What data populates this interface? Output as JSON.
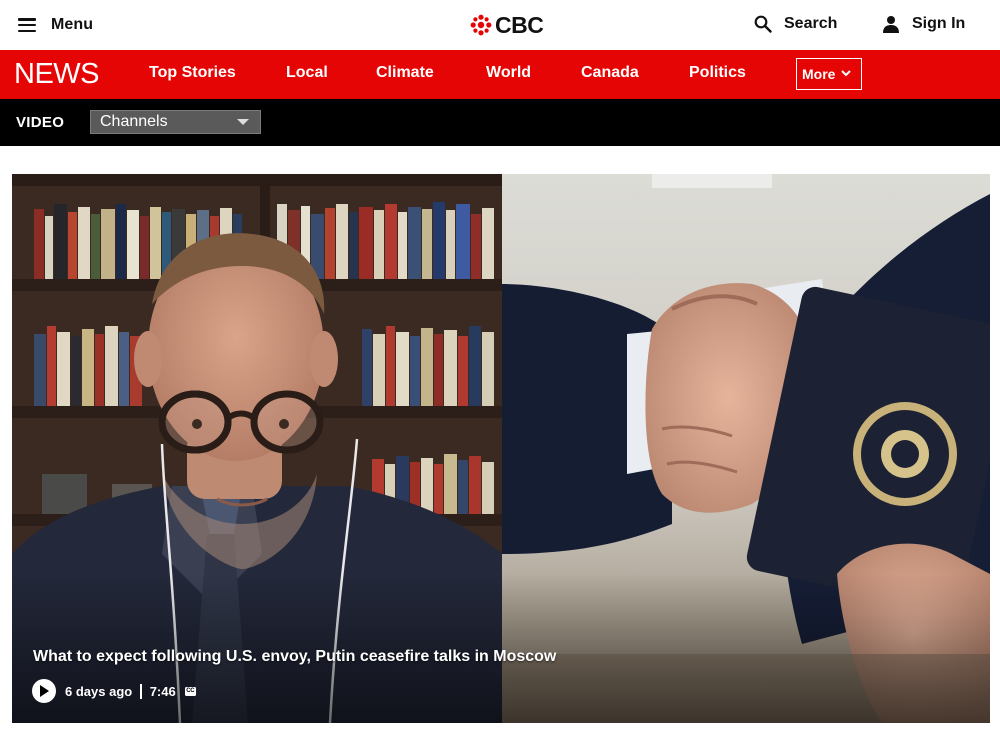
{
  "header": {
    "menu_label": "Menu",
    "logo_text": "CBC",
    "search_label": "Search",
    "signin_label": "Sign In"
  },
  "news_nav": {
    "section_label": "NEWS",
    "items": [
      {
        "label": "Top Stories"
      },
      {
        "label": "Local"
      },
      {
        "label": "Climate"
      },
      {
        "label": "World"
      },
      {
        "label": "Canada"
      },
      {
        "label": "Politics"
      }
    ],
    "more_label": "More"
  },
  "video_bar": {
    "label": "VIDEO",
    "channels_selected": "Channels"
  },
  "featured_video": {
    "title": "What to expect following U.S. envoy, Putin ceasefire talks in Moscow",
    "age": "6 days ago",
    "duration": "7:46",
    "cc_label": "CC"
  },
  "icons": {
    "menu": "hamburger-icon",
    "search": "search-icon",
    "signin": "user-icon",
    "more": "chevron-down-icon",
    "play": "play-icon",
    "captions": "closed-captions-icon"
  },
  "colors": {
    "brand_red": "#e60505",
    "video_bar": "#000000",
    "channels_select": "#5a5a5a"
  }
}
